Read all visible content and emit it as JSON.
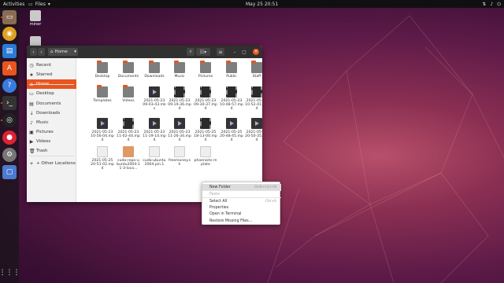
{
  "topbar": {
    "activities": "Activities",
    "app_menu": "Files",
    "clock": "May 25  20:51",
    "tray_icons": [
      "network-icon",
      "volume-icon",
      "power-icon"
    ]
  },
  "dock": {
    "apps": [
      "files-icon",
      "rhythmbox-icon",
      "writer-icon",
      "software-icon",
      "help-icon",
      "terminal-icon",
      "obs-icon",
      "chrome-icon",
      "settings-icon",
      "window-icon"
    ],
    "show_apps": "grid-icon"
  },
  "desktop": {
    "icons": [
      {
        "label": "miner"
      },
      {
        "label": ""
      }
    ]
  },
  "window": {
    "path_label": "Home",
    "sidebar": [
      {
        "label": "Recent",
        "icon": "clock-icon"
      },
      {
        "label": "Starred",
        "icon": "star-icon"
      },
      {
        "label": "Home",
        "icon": "home-icon",
        "active": true
      },
      {
        "label": "Desktop",
        "icon": "desktop-icon"
      },
      {
        "label": "Documents",
        "icon": "documents-icon"
      },
      {
        "label": "Downloads",
        "icon": "downloads-icon"
      },
      {
        "label": "Music",
        "icon": "music-icon"
      },
      {
        "label": "Pictures",
        "icon": "pictures-icon"
      },
      {
        "label": "Videos",
        "icon": "videos-icon"
      },
      {
        "label": "Trash",
        "icon": "trash-icon"
      },
      {
        "label": "+ Other Locations",
        "icon": "plus-icon"
      }
    ],
    "files": [
      {
        "label": "Desktop",
        "kind": "folder"
      },
      {
        "label": "Documents",
        "kind": "folder"
      },
      {
        "label": "Downloads",
        "kind": "folder"
      },
      {
        "label": "Music",
        "kind": "folder"
      },
      {
        "label": "Pictures",
        "kind": "folder"
      },
      {
        "label": "Public",
        "kind": "folder"
      },
      {
        "label": "Staff",
        "kind": "folder"
      },
      {
        "label": "Templates",
        "kind": "folder"
      },
      {
        "label": "Videos",
        "kind": "folder"
      },
      {
        "label": "2021-05-23 09-03-43.mkv",
        "kind": "vid"
      },
      {
        "label": "2021-05-23 09-19-36.mp4",
        "kind": "film"
      },
      {
        "label": "2021-05-23 09-30-37.mp4",
        "kind": "film"
      },
      {
        "label": "2021-05-23 10-48-57.mp4",
        "kind": "film"
      },
      {
        "label": "2021-05-23 10-52-41.mp4",
        "kind": "film"
      },
      {
        "label": "2021-05-23 10-56-04.mp4",
        "kind": "vid"
      },
      {
        "label": "2021-05-23 11-02-44.mp4",
        "kind": "film"
      },
      {
        "label": "2021-05-23 11-19-14.mp4",
        "kind": "vid"
      },
      {
        "label": "2021-05-23 11-26-34.mp4",
        "kind": "vid"
      },
      {
        "label": "2021-05-25 18-13-00.mp4",
        "kind": "film"
      },
      {
        "label": "2021-05-25 20-48-45.mp4",
        "kind": "vid"
      },
      {
        "label": "2021-05-25 20-50-35.mp4",
        "kind": "vid"
      },
      {
        "label": "2021-05-25 20-51-02.mp4",
        "kind": "doc"
      },
      {
        "label": "cuda-repo-ubuntu2004-11-3-loca...",
        "kind": "pinkd"
      },
      {
        "label": "cuda-ubuntu2004.pin.1",
        "kind": "doc"
      },
      {
        "label": "freemoney.sh",
        "kind": "doc"
      },
      {
        "label": "phoenixte mplate",
        "kind": "doc"
      }
    ]
  },
  "context_menu": [
    {
      "label": "New Folder",
      "shortcut": "Shift+Ctrl+N",
      "highlight": true
    },
    {
      "label": "Paste",
      "shortcut": "",
      "disabled": true
    },
    {
      "label": "Select All",
      "shortcut": "Ctrl+A"
    },
    {
      "label": "Properties",
      "shortcut": ""
    },
    {
      "label": "Open in Terminal",
      "shortcut": ""
    },
    {
      "label": "Restore Missing Files...",
      "shortcut": ""
    }
  ],
  "colors": {
    "accent": "#e9541f",
    "header": "#303030",
    "sidebar": "#f2f2f2"
  }
}
